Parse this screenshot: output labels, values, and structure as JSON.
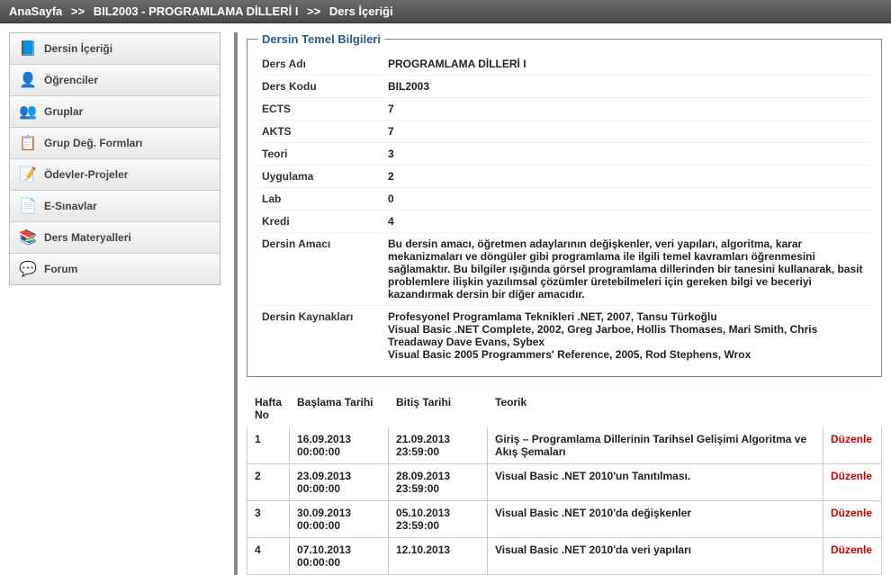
{
  "breadcrumb": {
    "items": [
      "AnaSayfa",
      "BIL2003 - PROGRAMLAMA DİLLERİ I",
      "Ders İçeriği"
    ],
    "sep": ">>"
  },
  "sidebar": {
    "items": [
      {
        "label": "Dersin İçeriği",
        "icon": "📘"
      },
      {
        "label": "Öğrenciler",
        "icon": "👤"
      },
      {
        "label": "Gruplar",
        "icon": "👥"
      },
      {
        "label": "Grup Değ. Formları",
        "icon": "📋"
      },
      {
        "label": "Ödevler-Projeler",
        "icon": "📝"
      },
      {
        "label": "E-Sınavlar",
        "icon": "📄"
      },
      {
        "label": "Ders Materyalleri",
        "icon": "📚"
      },
      {
        "label": "Forum",
        "icon": "💬"
      }
    ]
  },
  "info": {
    "legend": "Dersin Temel Bilgileri",
    "rows": [
      {
        "label": "Ders Adı",
        "value": "PROGRAMLAMA DİLLERİ I"
      },
      {
        "label": "Ders Kodu",
        "value": "BIL2003"
      },
      {
        "label": "ECTS",
        "value": "7"
      },
      {
        "label": "AKTS",
        "value": "7"
      },
      {
        "label": "Teori",
        "value": "3"
      },
      {
        "label": "Uygulama",
        "value": "2"
      },
      {
        "label": "Lab",
        "value": "0"
      },
      {
        "label": "Kredi",
        "value": "4"
      },
      {
        "label": "Dersin Amacı",
        "value": "Bu dersin amacı, öğretmen adaylarının değişkenler, veri yapıları, algoritma, karar mekanizmaları ve döngüler gibi programlama ile ilgili temel kavramları öğrenmesini sağlamaktır. Bu bilgiler ışığında görsel programlama dillerinden bir tanesini kullanarak, basit problemlere ilişkin yazılımsal çözümler üretebilmeleri için gereken bilgi ve beceriyi kazandırmak dersin bir diğer amacıdır."
      },
      {
        "label": "Dersin Kaynakları",
        "value": "Profesyonel Programlama Teknikleri .NET, 2007, Tansu Türkoğlu\nVisual Basic .NET Complete, 2002, Greg Jarboe, Hollis Thomases, Mari Smith, Chris Treadaway Dave Evans, Sybex\nVisual Basic 2005 Programmers' Reference, 2005, Rod Stephens, Wrox"
      }
    ]
  },
  "weeks": {
    "headers": {
      "no": "Hafta No",
      "start": "Başlama Tarihi",
      "end": "Bitiş Tarihi",
      "theory": "Teorik",
      "edit": ""
    },
    "edit_label": "Düzenle",
    "rows": [
      {
        "no": "1",
        "start": "16.09.2013 00:00:00",
        "end": "21.09.2013 23:59:00",
        "theory": "Giriş – Programlama Dillerinin Tarihsel Gelişimi Algoritma ve Akış Şemaları"
      },
      {
        "no": "2",
        "start": "23.09.2013 00:00:00",
        "end": "28.09.2013 23:59:00",
        "theory": "Visual Basic .NET 2010'un Tanıtılması."
      },
      {
        "no": "3",
        "start": "30.09.2013 00:00:00",
        "end": "05.10.2013 23:59:00",
        "theory": "Visual Basic .NET 2010'da değişkenler"
      },
      {
        "no": "4",
        "start": "07.10.2013 00:00:00",
        "end": "12.10.2013",
        "theory": "Visual Basic .NET 2010'da veri yapıları"
      }
    ]
  }
}
